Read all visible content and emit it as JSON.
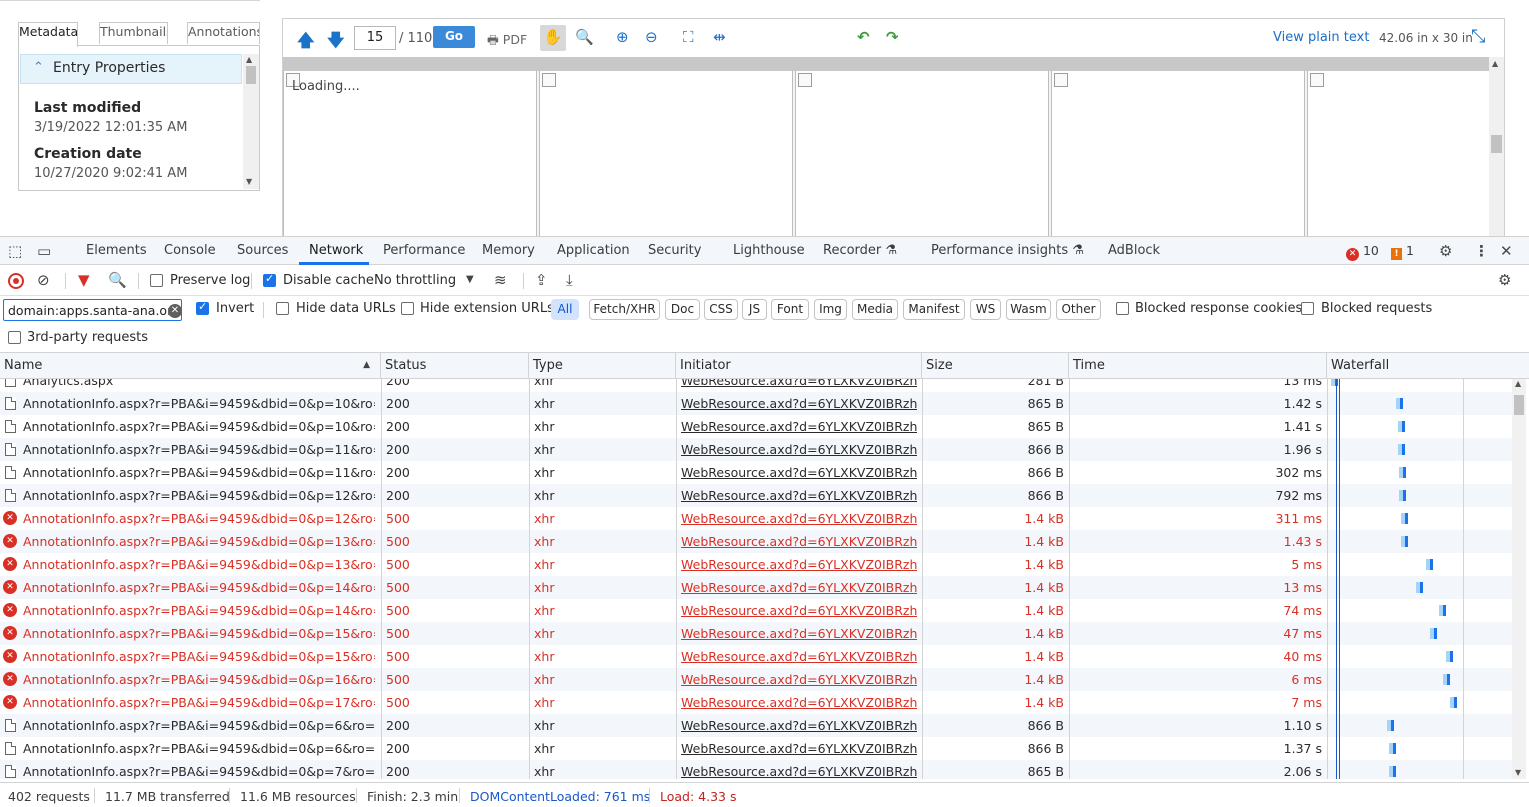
{
  "viewer_page": {
    "metadata_tabs": [
      "Metadata",
      "Thumbnails",
      "Annotations"
    ],
    "entry_properties": "Entry Properties",
    "fields": [
      {
        "label": "Last modified",
        "value": "3/19/2022 12:01:35 AM"
      },
      {
        "label": "Creation date",
        "value": "10/27/2020 9:02:41 AM"
      }
    ],
    "toolbar": {
      "page_value": "15",
      "page_total": "/ 110",
      "go_label": "Go",
      "pdf_label": "PDF",
      "view_plain_text": "View plain text",
      "dimensions": "42.06 in x 30 in"
    },
    "loading_text": "Loading...."
  },
  "devtools": {
    "tabs": [
      "Elements",
      "Console",
      "Sources",
      "Network",
      "Performance",
      "Memory",
      "Application",
      "Security",
      "Lighthouse",
      "Recorder",
      "Performance insights",
      "AdBlock"
    ],
    "active_tab": "Network",
    "error_count": "10",
    "warning_count": "1",
    "toolbar": {
      "preserve_log": "Preserve log",
      "disable_cache": "Disable cache",
      "throttling": "No throttling"
    },
    "filter": {
      "value": "domain:apps.santa-ana.org",
      "invert": "Invert",
      "hide_data_urls": "Hide data URLs",
      "hide_extension_urls": "Hide extension URLs",
      "types": [
        "All",
        "Fetch/XHR",
        "Doc",
        "CSS",
        "JS",
        "Font",
        "Img",
        "Media",
        "Manifest",
        "WS",
        "Wasm",
        "Other"
      ],
      "blocked_response_cookies": "Blocked response cookies",
      "blocked_requests": "Blocked requests",
      "third_party": "3rd-party requests"
    },
    "columns": [
      "Name",
      "Status",
      "Type",
      "Initiator",
      "Size",
      "Time",
      "Waterfall"
    ],
    "rows": [
      {
        "name": "Analytics.aspx",
        "status": "200",
        "type": "xhr",
        "initiator": "WebResource.axd?d=6YLXKVZ0IBRzhD...",
        "size": "281 B",
        "time": "13 ms",
        "error": false,
        "wf": 0
      },
      {
        "name": "AnnotationInfo.aspx?r=PBA&i=9459&dbid=0&p=10&ro=...",
        "status": "200",
        "type": "xhr",
        "initiator": "WebResource.axd?d=6YLXKVZ0IBRzhD...",
        "size": "865 B",
        "time": "1.42 s",
        "error": false,
        "wf": 0.36
      },
      {
        "name": "AnnotationInfo.aspx?r=PBA&i=9459&dbid=0&p=10&ro=...",
        "status": "200",
        "type": "xhr",
        "initiator": "WebResource.axd?d=6YLXKVZ0IBRzhD...",
        "size": "865 B",
        "time": "1.41 s",
        "error": false,
        "wf": 0.37
      },
      {
        "name": "AnnotationInfo.aspx?r=PBA&i=9459&dbid=0&p=11&ro=...",
        "status": "200",
        "type": "xhr",
        "initiator": "WebResource.axd?d=6YLXKVZ0IBRzhD...",
        "size": "866 B",
        "time": "1.96 s",
        "error": false,
        "wf": 0.37
      },
      {
        "name": "AnnotationInfo.aspx?r=PBA&i=9459&dbid=0&p=11&ro=...",
        "status": "200",
        "type": "xhr",
        "initiator": "WebResource.axd?d=6YLXKVZ0IBRzhD...",
        "size": "866 B",
        "time": "302 ms",
        "error": false,
        "wf": 0.38
      },
      {
        "name": "AnnotationInfo.aspx?r=PBA&i=9459&dbid=0&p=12&ro=...",
        "status": "200",
        "type": "xhr",
        "initiator": "WebResource.axd?d=6YLXKVZ0IBRzhD...",
        "size": "866 B",
        "time": "792 ms",
        "error": false,
        "wf": 0.38
      },
      {
        "name": "AnnotationInfo.aspx?r=PBA&i=9459&dbid=0&p=12&ro=...",
        "status": "500",
        "type": "xhr",
        "initiator": "WebResource.axd?d=6YLXKVZ0IBRzhD...",
        "size": "1.4 kB",
        "time": "311 ms",
        "error": true,
        "wf": 0.39
      },
      {
        "name": "AnnotationInfo.aspx?r=PBA&i=9459&dbid=0&p=13&ro=...",
        "status": "500",
        "type": "xhr",
        "initiator": "WebResource.axd?d=6YLXKVZ0IBRzhD...",
        "size": "1.4 kB",
        "time": "1.43 s",
        "error": true,
        "wf": 0.39
      },
      {
        "name": "AnnotationInfo.aspx?r=PBA&i=9459&dbid=0&p=13&ro=...",
        "status": "500",
        "type": "xhr",
        "initiator": "WebResource.axd?d=6YLXKVZ0IBRzhD...",
        "size": "1.4 kB",
        "time": "5 ms",
        "error": true,
        "wf": 0.53
      },
      {
        "name": "AnnotationInfo.aspx?r=PBA&i=9459&dbid=0&p=14&ro=...",
        "status": "500",
        "type": "xhr",
        "initiator": "WebResource.axd?d=6YLXKVZ0IBRzhD...",
        "size": "1.4 kB",
        "time": "13 ms",
        "error": true,
        "wf": 0.47
      },
      {
        "name": "AnnotationInfo.aspx?r=PBA&i=9459&dbid=0&p=14&ro=...",
        "status": "500",
        "type": "xhr",
        "initiator": "WebResource.axd?d=6YLXKVZ0IBRzhD...",
        "size": "1.4 kB",
        "time": "74 ms",
        "error": true,
        "wf": 0.6
      },
      {
        "name": "AnnotationInfo.aspx?r=PBA&i=9459&dbid=0&p=15&ro=...",
        "status": "500",
        "type": "xhr",
        "initiator": "WebResource.axd?d=6YLXKVZ0IBRzhD...",
        "size": "1.4 kB",
        "time": "47 ms",
        "error": true,
        "wf": 0.55
      },
      {
        "name": "AnnotationInfo.aspx?r=PBA&i=9459&dbid=0&p=15&ro=...",
        "status": "500",
        "type": "xhr",
        "initiator": "WebResource.axd?d=6YLXKVZ0IBRzhD...",
        "size": "1.4 kB",
        "time": "40 ms",
        "error": true,
        "wf": 0.64
      },
      {
        "name": "AnnotationInfo.aspx?r=PBA&i=9459&dbid=0&p=16&ro=...",
        "status": "500",
        "type": "xhr",
        "initiator": "WebResource.axd?d=6YLXKVZ0IBRzhD...",
        "size": "1.4 kB",
        "time": "6 ms",
        "error": true,
        "wf": 0.62
      },
      {
        "name": "AnnotationInfo.aspx?r=PBA&i=9459&dbid=0&p=17&ro=...",
        "status": "500",
        "type": "xhr",
        "initiator": "WebResource.axd?d=6YLXKVZ0IBRzhD...",
        "size": "1.4 kB",
        "time": "7 ms",
        "error": true,
        "wf": 0.66
      },
      {
        "name": "AnnotationInfo.aspx?r=PBA&i=9459&dbid=0&p=6&ro=0...",
        "status": "200",
        "type": "xhr",
        "initiator": "WebResource.axd?d=6YLXKVZ0IBRzhD...",
        "size": "866 B",
        "time": "1.10 s",
        "error": false,
        "wf": 0.31
      },
      {
        "name": "AnnotationInfo.aspx?r=PBA&i=9459&dbid=0&p=6&ro=0...",
        "status": "200",
        "type": "xhr",
        "initiator": "WebResource.axd?d=6YLXKVZ0IBRzhD...",
        "size": "866 B",
        "time": "1.37 s",
        "error": false,
        "wf": 0.32
      },
      {
        "name": "AnnotationInfo.aspx?r=PBA&i=9459&dbid=0&p=7&ro=0...",
        "status": "200",
        "type": "xhr",
        "initiator": "WebResource.axd?d=6YLXKVZ0IBRzhD...",
        "size": "865 B",
        "time": "2.06 s",
        "error": false,
        "wf": 0.32
      }
    ],
    "status_bar": {
      "requests": "402 requests",
      "transferred": "11.7 MB transferred",
      "resources": "11.6 MB resources",
      "finish": "Finish: 2.3 min",
      "dom_content_loaded": "DOMContentLoaded: 761 ms",
      "load": "Load: 4.33 s"
    },
    "colors": {
      "accent": "#1a73e8",
      "error": "#d93025",
      "dom_line": "#1a57c9",
      "load_line": "#c5221f"
    }
  }
}
